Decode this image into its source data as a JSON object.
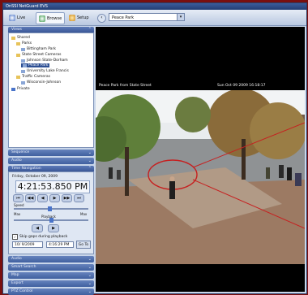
{
  "window": {
    "title": "OnSSI NetGuard EVS"
  },
  "toolbar": {
    "live_label": "Live",
    "browse_label": "Browse",
    "setup_label": "Setup"
  },
  "camera_select": {
    "value": "Peace Park"
  },
  "views": {
    "header": "Views",
    "tree": [
      {
        "label": "Shared"
      },
      {
        "label": "Parks"
      },
      {
        "label": "Bittingham Park"
      },
      {
        "label": "State Street Cameras"
      },
      {
        "label": "Johnson State-Dorham"
      },
      {
        "label": "Peace Park"
      },
      {
        "label": "University Lake Francis"
      },
      {
        "label": "Traffic Cameras"
      },
      {
        "label": "Wisconsin-Johnson"
      },
      {
        "label": "Private"
      }
    ]
  },
  "panels": {
    "p1": "Sequence",
    "p2": "Audio"
  },
  "time_nav": {
    "header": "Time Navigation",
    "date": "Friday, October 09, 2009",
    "time": "4:21:53.850 PM",
    "speed_label": "Speed",
    "scale_min": "Max",
    "scale_max": "Max",
    "playback_label": "Playback",
    "skip_label": "Skip gaps during playback",
    "date_field": "10/ 9/2009",
    "time_field": "4:16:29 PM",
    "goto_label": "Go To"
  },
  "bottom_panels": [
    "Audio",
    "Smart Search",
    "Map",
    "Export",
    "PTZ Control"
  ],
  "video": {
    "caption": "Peace Park from State Street",
    "timestamp": "Sun Oct 09 2009 16:18:17"
  }
}
